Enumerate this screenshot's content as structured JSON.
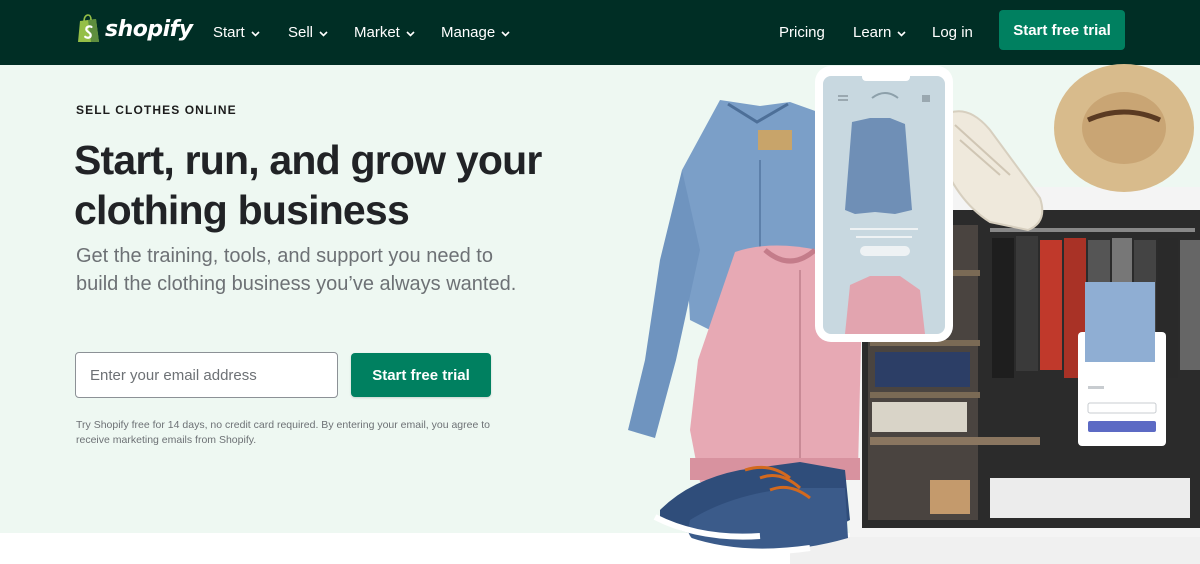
{
  "brand": {
    "name": "shopify"
  },
  "nav": {
    "items": [
      {
        "label": "Start",
        "has_dropdown": true
      },
      {
        "label": "Sell",
        "has_dropdown": true
      },
      {
        "label": "Market",
        "has_dropdown": true
      },
      {
        "label": "Manage",
        "has_dropdown": true
      }
    ],
    "right": [
      {
        "label": "Pricing",
        "has_dropdown": false
      },
      {
        "label": "Learn",
        "has_dropdown": true
      },
      {
        "label": "Log in",
        "has_dropdown": false
      }
    ],
    "cta_label": "Start free trial"
  },
  "hero": {
    "eyebrow": "SELL CLOTHES ONLINE",
    "headline_line1": "Start, run, and grow your",
    "headline_line2": "clothing business",
    "subhead": "Get the training, tools, and support you need to build the clothing business you’ve always wanted.",
    "email_placeholder": "Enter your email address",
    "email_value": "",
    "submit_label": "Start free trial",
    "legal": "Try Shopify free for 14 days, no credit card required. By entering your email, you agree to receive marketing emails from Shopify."
  },
  "colors": {
    "header_bg": "#002e25",
    "hero_bg": "#eef8f2",
    "accent": "#008060",
    "text_dark": "#212326",
    "text_muted": "#6d7175"
  }
}
